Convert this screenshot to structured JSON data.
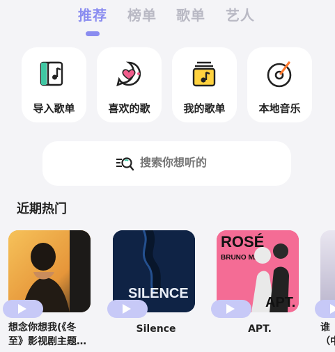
{
  "tabs": [
    {
      "label": "推荐",
      "active": true
    },
    {
      "label": "榜单",
      "active": false
    },
    {
      "label": "歌单",
      "active": false
    },
    {
      "label": "艺人",
      "active": false
    }
  ],
  "quick_actions": [
    {
      "label": "导入歌单",
      "icon": "import-playlist-icon"
    },
    {
      "label": "喜欢的歌",
      "icon": "heart-chat-icon"
    },
    {
      "label": "我的歌单",
      "icon": "playlist-icon"
    },
    {
      "label": "本地音乐",
      "icon": "local-disc-icon"
    }
  ],
  "search": {
    "placeholder": "搜索你想听的"
  },
  "section": {
    "title": "近期热门"
  },
  "songs": [
    {
      "title_line1": "想念你想我(《冬",
      "title_line2": "至》影视剧主题…",
      "cover_text": ""
    },
    {
      "title": "Silence",
      "cover_text": "SILENCE"
    },
    {
      "title": "APT.",
      "cover_text_top": "ROSÉ",
      "cover_text_mid": "BRUNO MARS",
      "cover_text_bottom": "APT."
    },
    {
      "title_line1": "谁",
      "title_line2": "（中"
    }
  ],
  "colors": {
    "accent": "#8a8cf0",
    "inactive_tab": "#b9b9c4",
    "background": "#f4f4f7",
    "play_pill": "#c7c9f7"
  }
}
